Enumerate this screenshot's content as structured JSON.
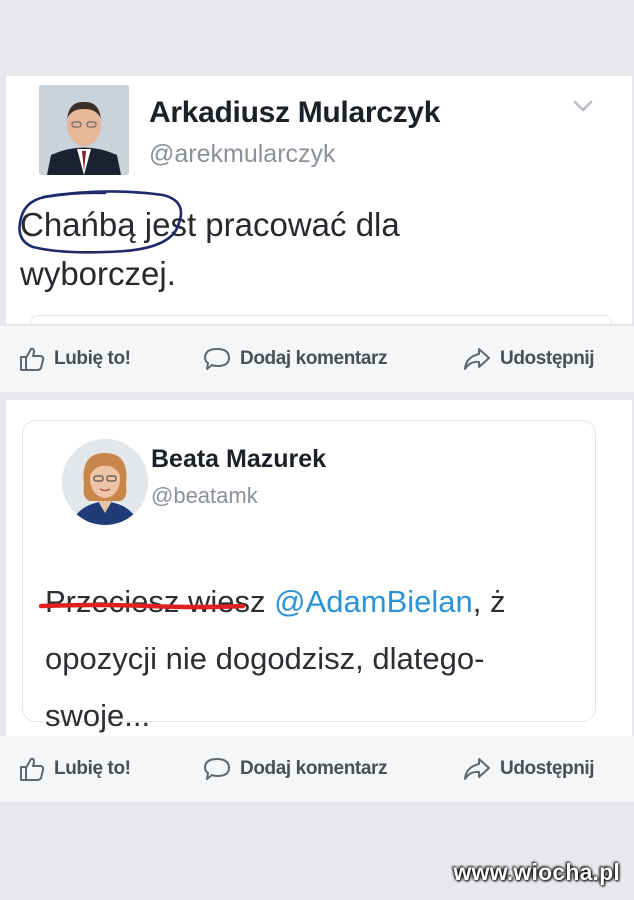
{
  "posts": [
    {
      "author": "Arkadiusz Mularczyk",
      "handle": "@arekmularczyk",
      "text_line1_marked": "Chańbą",
      "text_line1_rest": " jest pracować dla",
      "text_line2": "wyborczej."
    },
    {
      "author": "Beata Mazurek",
      "handle": "@beatamk",
      "text_marked": "Przeciesz wiesz",
      "mention": "@AdamBielan",
      "text_after_mention": ", ż",
      "text_line2": "opozycji nie dogodzisz, dlatego-",
      "text_line3": "swoje..."
    }
  ],
  "actions": {
    "like": "Lubię to!",
    "comment": "Dodaj komentarz",
    "share": "Udostępnij"
  },
  "annotation_colors": {
    "circle": "#1f2a6b",
    "underline": "#e02020"
  },
  "watermark": "www.wiocha.pl"
}
